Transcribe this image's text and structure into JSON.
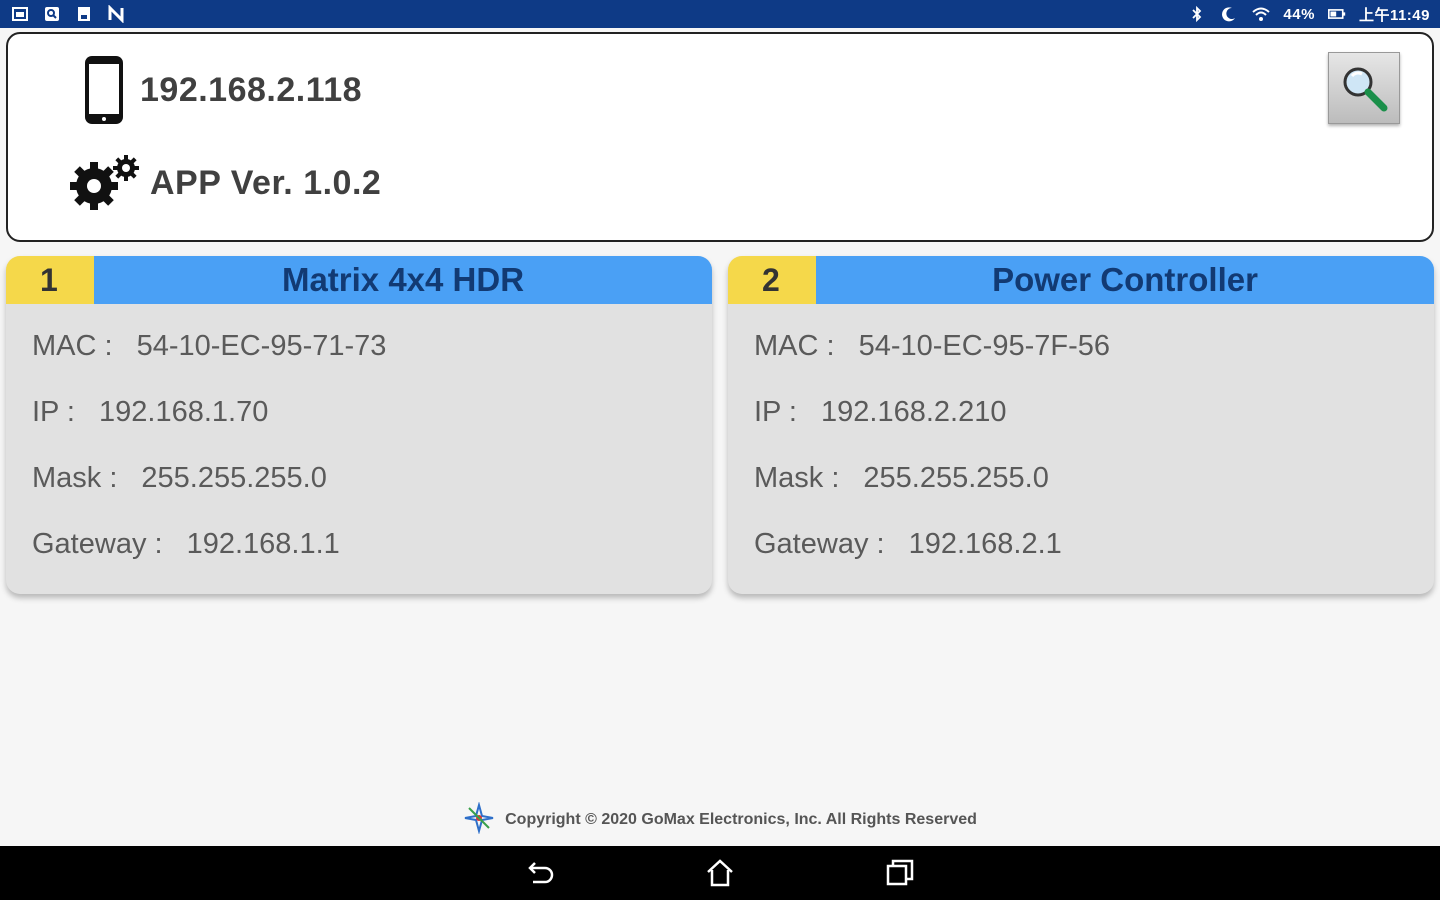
{
  "status_bar": {
    "left_icons": [
      "gallery-icon",
      "search-app-icon",
      "save-icon",
      "n-app-icon"
    ],
    "right_icons": [
      "bluetooth-icon",
      "moon-icon",
      "wifi-icon"
    ],
    "battery": "44%",
    "time": "上午11:49"
  },
  "header": {
    "device_ip": "192.168.2.118",
    "app_version": "APP Ver. 1.0.2"
  },
  "devices": [
    {
      "number": "1",
      "name": "Matrix 4x4 HDR",
      "mac_label": "MAC :",
      "mac": "54-10-EC-95-71-73",
      "ip_label": "IP :",
      "ip": "192.168.1.70",
      "mask_label": "Mask :",
      "mask": "255.255.255.0",
      "gateway_label": "Gateway :",
      "gateway": "192.168.1.1"
    },
    {
      "number": "2",
      "name": "Power Controller",
      "mac_label": "MAC :",
      "mac": "54-10-EC-95-7F-56",
      "ip_label": "IP :",
      "ip": "192.168.2.210",
      "mask_label": "Mask :",
      "mask": "255.255.255.0",
      "gateway_label": "Gateway :",
      "gateway": "192.168.2.1"
    }
  ],
  "footer": {
    "copyright": "Copyright © 2020 GoMax Electronics, Inc. All Rights Reserved"
  },
  "colors": {
    "status_bar": "#0e3a86",
    "card_number": "#f5d84a",
    "card_title": "#4aa0f5",
    "card_body": "#e1e1e1"
  }
}
